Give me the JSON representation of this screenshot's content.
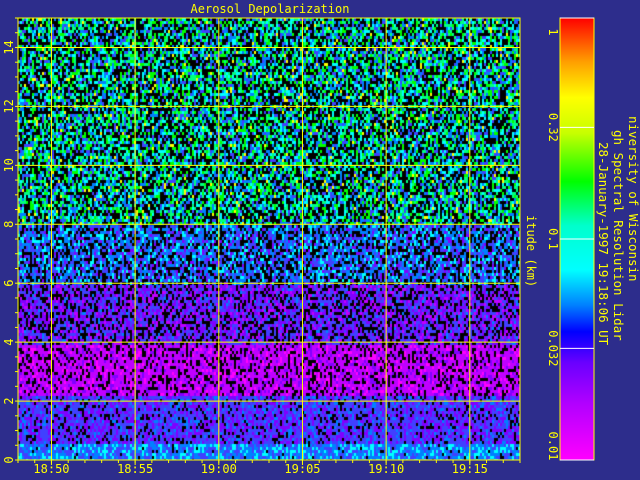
{
  "chart_data": {
    "type": "heatmap",
    "title": "Aerosol Depolarization",
    "ylabel": "itude (km)",
    "x_ticks": [
      "18:50",
      "18:55",
      "19:00",
      "19:05",
      "19:10",
      "19:15"
    ],
    "y_ticks": [
      "0",
      "2",
      "4",
      "6",
      "8",
      "10",
      "12",
      "14"
    ],
    "xlim": [
      "18:48",
      "19:18"
    ],
    "ylim": [
      0,
      15
    ],
    "grid": true,
    "colorbar": {
      "scale": "log",
      "range": [
        0.01,
        1
      ],
      "ticks": [
        "0.01",
        "0.032",
        "0.1",
        "0.32",
        "1"
      ],
      "colors": [
        "#ff00ff",
        "#8000ff",
        "#0000ff",
        "#00ffff",
        "#00ff00",
        "#ffff00",
        "#ff8000",
        "#ff0000"
      ]
    }
  },
  "info_text": {
    "line1": "niversity of Wisconsin",
    "line2": "gh Spectral Resolution Lidar",
    "line3": "28-January-1997 19:18:06 UT"
  },
  "colors": {
    "background": "#2d2d8c",
    "axis": "#ffff00",
    "grid": "#ffff00"
  }
}
